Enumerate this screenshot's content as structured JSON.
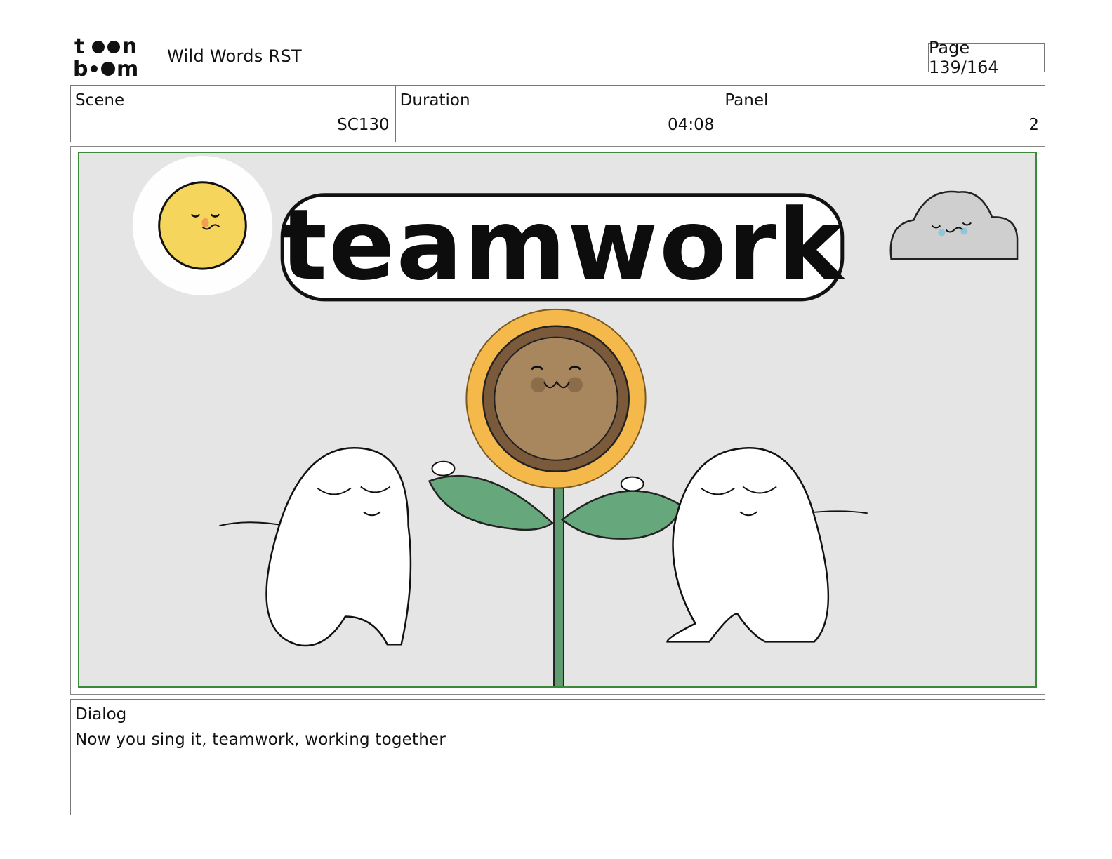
{
  "header": {
    "logo_text": "toon boom",
    "project_title": "Wild Words RST",
    "page_indicator": "Page 139/164"
  },
  "info": {
    "scene_label": "Scene",
    "scene_value": "SC130",
    "duration_label": "Duration",
    "duration_value": "04:08",
    "panel_label": "Panel",
    "panel_value": "2"
  },
  "panel": {
    "title_word": "teamwork",
    "colors": {
      "background": "#e5e5e5",
      "frame_border": "#3b8a3b",
      "sun": "#f6d55c",
      "petals": "#f5b84a",
      "flower_center": "#a8875f",
      "leaf": "#66a77b"
    }
  },
  "dialog": {
    "label": "Dialog",
    "text": "Now you sing it, teamwork, working together"
  }
}
